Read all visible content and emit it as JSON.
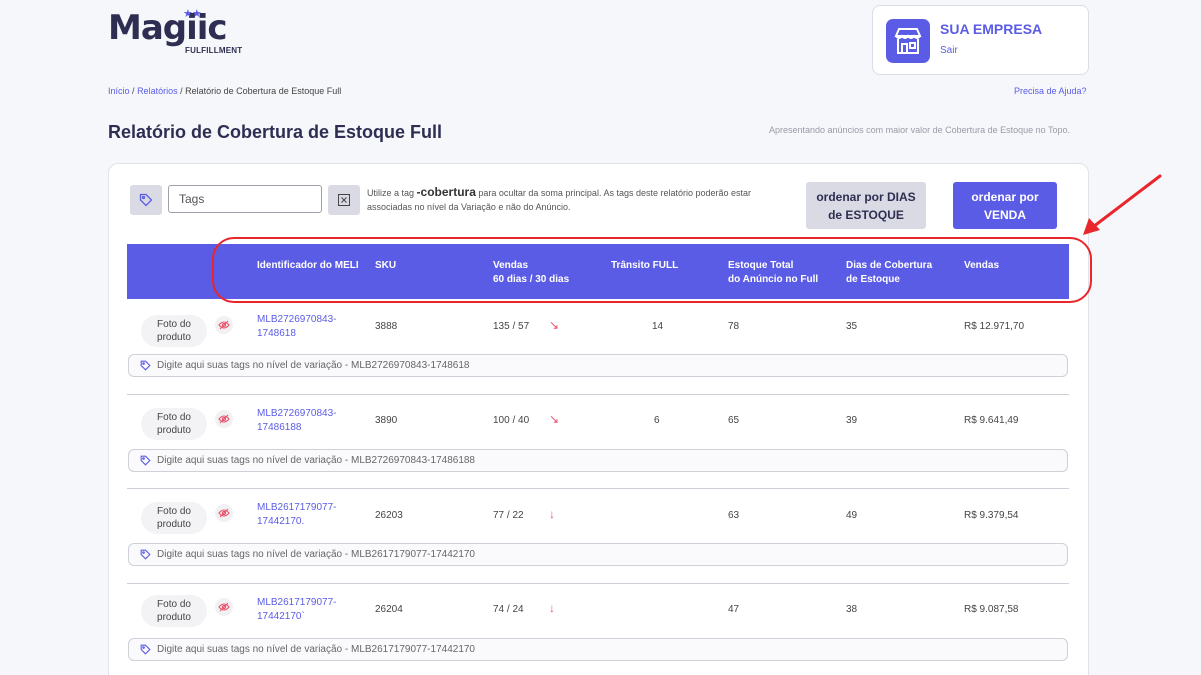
{
  "brand": {
    "name": "Magiic",
    "sub": "FULFILLMENT",
    "stars": "★★"
  },
  "company": {
    "name": "SUA EMPRESA",
    "logout": "Sair"
  },
  "breadcrumb": {
    "home": "Início",
    "sep": "/",
    "reports": "Relatórios",
    "current": "Relatório de Cobertura de Estoque Full"
  },
  "help": "Precisa de Ajuda?",
  "page": {
    "title": "Relatório de Cobertura de Estoque Full",
    "subtitle": "Apresentando anúncios com maior valor de Cobertura de Estoque no Topo."
  },
  "filters": {
    "tags_placeholder": "Tags",
    "hint_pre": "Utilize a tag ",
    "hint_tag": "-cobertura",
    "hint_post": " para ocultar da soma principal. As tags deste relatório poderão estar associadas no nível da Variação e não do Anúncio."
  },
  "buttons": {
    "sort_days_1": "ordenar por DIAS",
    "sort_days_2": "de ESTOQUE",
    "sort_sales_1": "ordenar por",
    "sort_sales_2": "VENDA"
  },
  "columns": {
    "meli": "Identificador do MELI",
    "sku": "SKU",
    "sales_1": "Vendas",
    "sales_2": "60 dias / 30 dias",
    "transit": "Trânsito FULL",
    "stock_1": "Estoque Total",
    "stock_2": "do Anúncio no Full",
    "coverage_1": "Dias de Cobertura",
    "coverage_2": "de Estoque",
    "revenue": "Vendas"
  },
  "rows": [
    {
      "photo_1": "Foto do",
      "photo_2": "produto",
      "meli_1": "MLB2726970843-",
      "meli_2": "1748618",
      "sku": "3888",
      "sales": "135 / 57",
      "trend": "↘",
      "transit": "14",
      "stock": "78",
      "coverage": "35",
      "revenue": "R$ 12.971,70",
      "tag_hint": "Digite aqui suas tags no nível de variação - MLB2726970843-1748618"
    },
    {
      "photo_1": "Foto do",
      "photo_2": "produto",
      "meli_1": "MLB2726970843-",
      "meli_2": "17486188",
      "sku": "3890",
      "sales": "100 / 40",
      "trend": "↘",
      "transit": "6",
      "stock": "65",
      "coverage": "39",
      "revenue": "R$ 9.641,49",
      "tag_hint": "Digite aqui suas tags no nível de variação - MLB2726970843-17486188"
    },
    {
      "photo_1": "Foto do",
      "photo_2": "produto",
      "meli_1": "MLB2617179077-",
      "meli_2": "17442170.",
      "sku": "26203",
      "sales": "77 / 22",
      "trend": "↓",
      "transit": "",
      "stock": "63",
      "coverage": "49",
      "revenue": "R$ 9.379,54",
      "tag_hint": "Digite aqui suas tags no nível de variação - MLB2617179077-17442170"
    },
    {
      "photo_1": "Foto do",
      "photo_2": "produto",
      "meli_1": "MLB2617179077-",
      "meli_2": "17442170`",
      "sku": "26204",
      "sales": "74 / 24",
      "trend": "↓",
      "transit": "",
      "stock": "47",
      "coverage": "38",
      "revenue": "R$ 9.087,58",
      "tag_hint": "Digite aqui suas tags no nível de variação - MLB2617179077-17442170"
    }
  ],
  "colors": {
    "accent": "#5b5ce6",
    "annotation": "#e8262b",
    "trend": "#e8546b"
  }
}
